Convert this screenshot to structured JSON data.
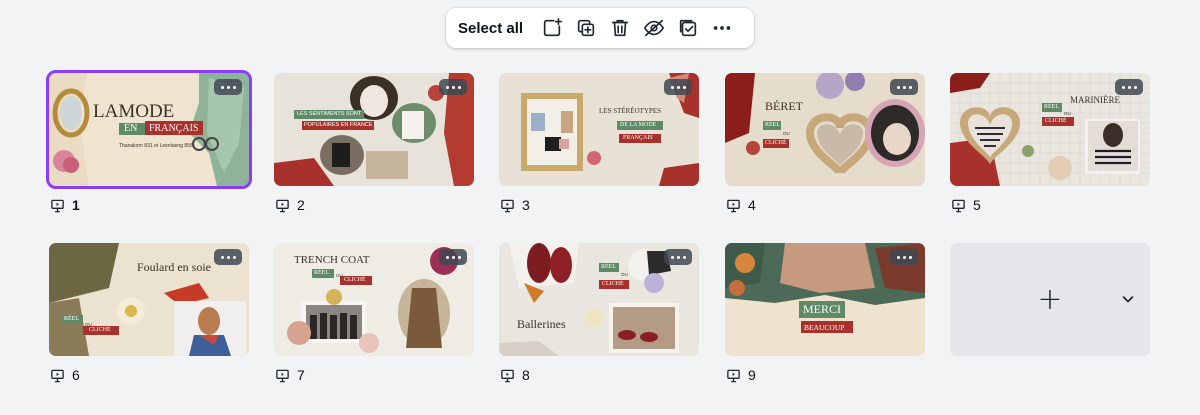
{
  "toolbar": {
    "select_all": "Select all",
    "icons": [
      "add-page-icon",
      "duplicate-icon",
      "trash-icon",
      "hide-icon",
      "select-check-icon",
      "more-icon"
    ]
  },
  "slides": [
    {
      "number": "1",
      "selected": true,
      "title_line1": "LAMODE",
      "title_line2": "EN",
      "title_line3": "FRANÇAIS",
      "subtitle": "Thanakorn 831 et Leenlaeng 855"
    },
    {
      "number": "2",
      "title_line1": "LES SENTIMENTS SONT",
      "title_line2": "POPULAIRES EN FRANCE"
    },
    {
      "number": "3",
      "title_line1": "LES STÉRÉOTYPES",
      "title_line2": "DE LA MODE",
      "title_line3": "FRANÇAIS"
    },
    {
      "number": "4",
      "title_line1": "BÉRET",
      "tag1": "RÉEL",
      "ou": "OU",
      "tag2": "CLICHÉ"
    },
    {
      "number": "5",
      "title_line1": "MARINIÈRE",
      "tag1": "RÉEL",
      "ou": "OU",
      "tag2": "CLICHÉ"
    },
    {
      "number": "6",
      "title_line1": "Foulard en soie",
      "tag1": "RÉEL",
      "ou": "OU",
      "tag2": "CLICHÉ"
    },
    {
      "number": "7",
      "title_line1": "TRENCH COAT",
      "tag1": "RÉEL",
      "ou": "OU",
      "tag2": "CLICHÉ"
    },
    {
      "number": "8",
      "title_line1": "Ballerines",
      "tag1": "RÉEL",
      "ou": "OU",
      "tag2": "CLICHÉ"
    },
    {
      "number": "9",
      "title_line1": "MERCI",
      "title_line2": "BEAUCOUP"
    }
  ],
  "add_tile": {
    "plus": "+"
  },
  "colors": {
    "accent": "#8b3dff",
    "green_tag": "#5e8a66",
    "red_tag": "#a8322b",
    "paper": "#ece2cf"
  }
}
